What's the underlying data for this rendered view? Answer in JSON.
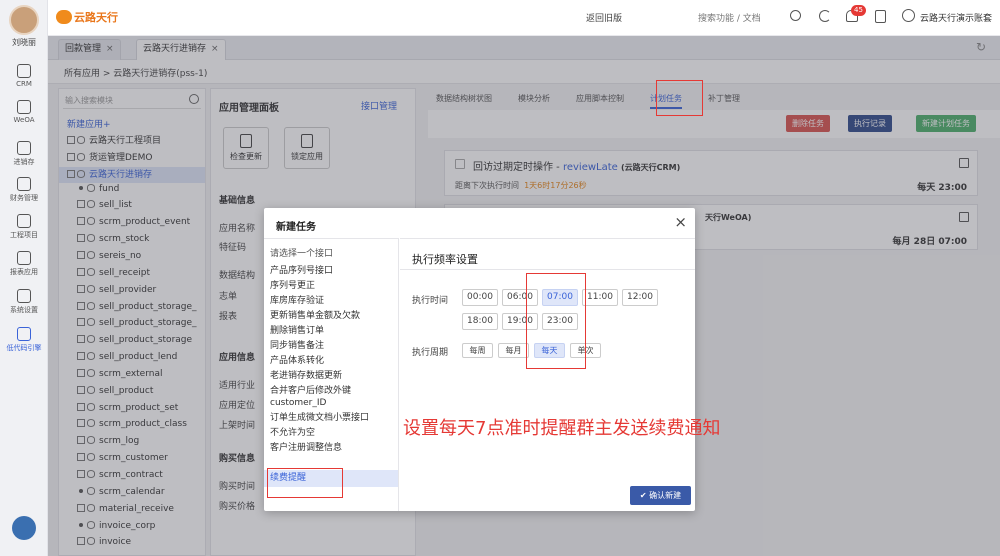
{
  "user": {
    "name": "刘晓丽"
  },
  "rail": [
    {
      "label": "CRM"
    },
    {
      "label": "WeOA"
    },
    {
      "label": "进销存"
    },
    {
      "label": "财务管理"
    },
    {
      "label": "工程项目"
    },
    {
      "label": "报表应用"
    },
    {
      "label": "系统设置"
    },
    {
      "label": "低代码引擎"
    }
  ],
  "topbar": {
    "logo": "云路天行",
    "back_old": "返回旧版",
    "search_placeholder": "搜索功能 / 文档",
    "notifications": "45",
    "account": "云路天行演示账套"
  },
  "tabs": [
    {
      "label": "回款管理",
      "close": "×"
    },
    {
      "label": "云路天行进销存",
      "close": "×"
    }
  ],
  "breadcrumb": "所有应用 > 云路天行进销存(pss-1)",
  "tree": {
    "search_placeholder": "输入搜索模块",
    "new_app": "新建应用+",
    "nodes": [
      "云路天行工程项目",
      "货运管理DEMO",
      "云路天行进销存",
      "fund",
      "sell_list",
      "scrm_product_event",
      "scrm_stock",
      "sereis_no",
      "sell_receipt",
      "sell_provider",
      "sell_product_storage_",
      "sell_product_storage_",
      "sell_product_storage",
      "sell_product_lend",
      "scrm_external",
      "sell_product",
      "scrm_product_set",
      "scrm_product_class",
      "scrm_log",
      "scrm_customer",
      "scrm_contract",
      "scrm_calendar",
      "material_receive",
      "invoice_corp",
      "invoice"
    ]
  },
  "app_panel": {
    "title": "应用管理面板",
    "api_link": "接口管理",
    "check_update": "检查更新",
    "lock_app": "锁定应用",
    "basic_info": "基础信息",
    "app_name": "应用名称",
    "feature_code": "特征码",
    "data_structure": "数据结构",
    "flag": "志单",
    "report": "报表",
    "app_info": "应用信息",
    "industry": "适用行业",
    "app_position": "应用定位",
    "launch_time": "上架时间",
    "purchase_info": "购买信息",
    "purchase_time": "购买时间",
    "purchase_price": "购买价格"
  },
  "op_tabs": [
    "数据结构树状图",
    "模块分析",
    "应用脚本控制",
    "计划任务",
    "补丁管理"
  ],
  "toolbar": {
    "delete": "删除任务",
    "log": "执行记录",
    "new": "新建计划任务"
  },
  "cards": [
    {
      "title": "回访过期定时操作 - ",
      "code": "reviewLate",
      "app": "(云路天行CRM)",
      "next_label": "距离下次执行时间",
      "next_value": "1天6时17分26秒",
      "freq": "每天 23:00"
    },
    {
      "app": "天行WeOA)",
      "freq": "每月  28日  07:00"
    }
  ],
  "modal": {
    "title": "新建任务",
    "close": "×",
    "iface_placeholder": "请选择一个接口",
    "interfaces": [
      "产品序列号接口",
      "序列号更正",
      "库房库存验证",
      "更新销售单金额及欠款",
      "删除销售订单",
      "同步销售备注",
      "产品体系转化",
      "老进销存数据更新",
      "合并客户后修改外键",
      "customer_ID",
      "订单生成微文档小票接口",
      "不允许为空",
      "客户注册调整信息",
      "续费提醒"
    ],
    "freq_title": "执行频率设置",
    "time_label": "执行时间",
    "times": [
      "00:00",
      "06:00",
      "07:00",
      "11:00",
      "12:00",
      "18:00",
      "19:00",
      "23:00"
    ],
    "period_label": "执行周期",
    "periods": [
      "每周",
      "每月",
      "每天",
      "单次"
    ],
    "confirm": "确认新建"
  },
  "annotation": "设置每天7点准时提醒群主发送续费通知"
}
